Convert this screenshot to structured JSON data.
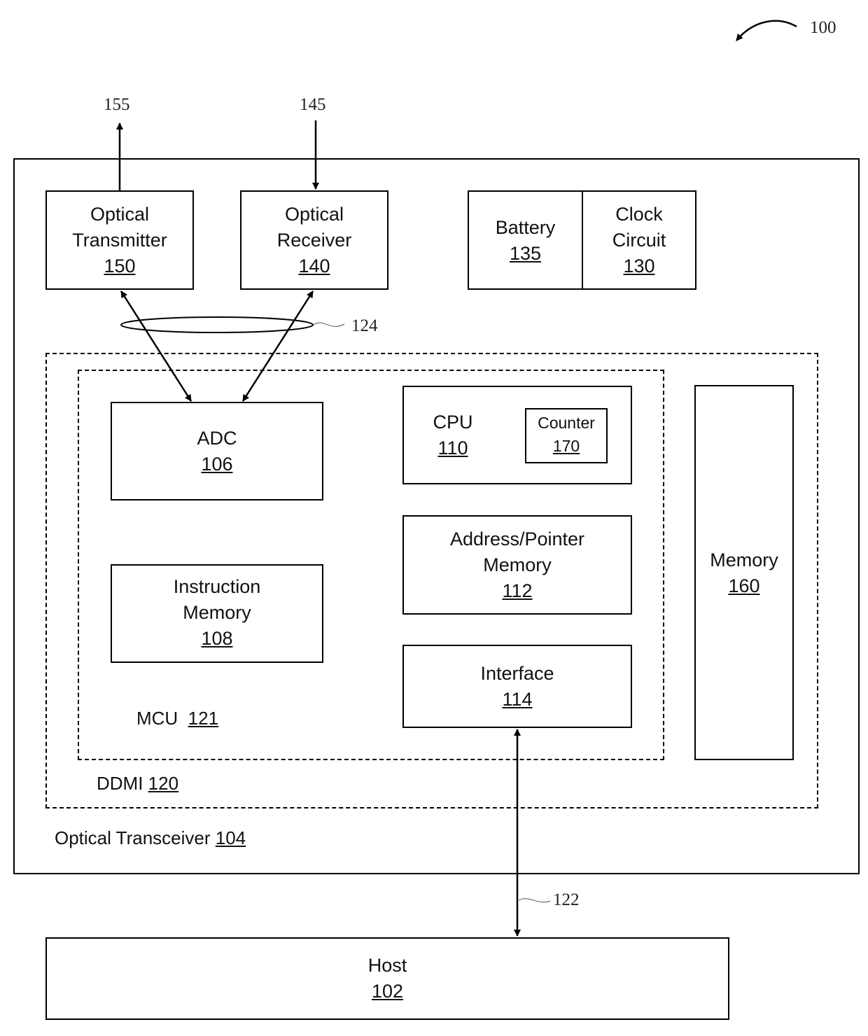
{
  "figure_ref": "100",
  "external_refs": {
    "tx_out": "155",
    "rx_in": "145",
    "bus": "124",
    "host_link": "122"
  },
  "transceiver": {
    "name": "Optical Transceiver",
    "ref": "104"
  },
  "ddmi": {
    "name": "DDMI",
    "ref": "120"
  },
  "mcu": {
    "name": "MCU",
    "ref": "121"
  },
  "blocks": {
    "optical_transmitter": {
      "line1": "Optical",
      "line2": "Transmitter",
      "ref": "150"
    },
    "optical_receiver": {
      "line1": "Optical",
      "line2": "Receiver",
      "ref": "140"
    },
    "battery": {
      "line1": "Battery",
      "ref": "135"
    },
    "clock_circuit": {
      "line1": "Clock",
      "line2": "Circuit",
      "ref": "130"
    },
    "adc": {
      "line1": "ADC",
      "ref": "106"
    },
    "instruction_memory": {
      "line1": "Instruction",
      "line2": "Memory",
      "ref": "108"
    },
    "cpu": {
      "line1": "CPU",
      "ref": "110"
    },
    "counter": {
      "line1": "Counter",
      "ref": "170"
    },
    "address_pointer_memory": {
      "line1": "Address/Pointer",
      "line2": "Memory",
      "ref": "112"
    },
    "interface": {
      "line1": "Interface",
      "ref": "114"
    },
    "memory": {
      "line1": "Memory",
      "ref": "160"
    },
    "host": {
      "line1": "Host",
      "ref": "102"
    }
  }
}
